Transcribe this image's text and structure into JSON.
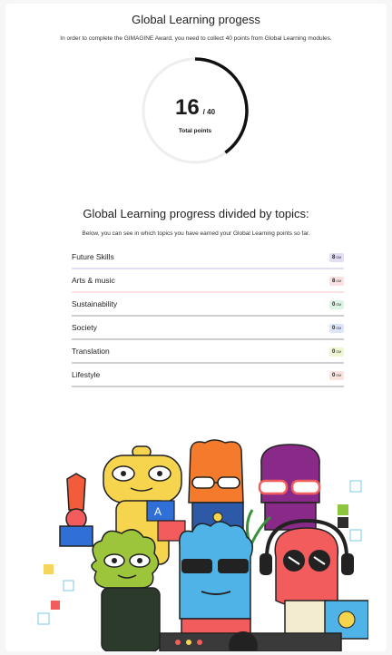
{
  "header": {
    "title": "Global Learning progess",
    "subtitle": "In order to complete the GIMAGINE Award, you need to collect 40 points from Global Learning modules."
  },
  "progress": {
    "points": "16",
    "total": "/ 40",
    "label": "Total points",
    "fraction": 0.4,
    "ring_color": "#111111",
    "track_color": "#eeeeee"
  },
  "topics_section": {
    "title": "Global Learning progress divided by topics:",
    "subtitle": "Below, you can see in which topics you have earned your Global Learning points so far.",
    "unit": "GM",
    "items": [
      {
        "name": "Future Skills",
        "points": "8",
        "fraction": 1.0,
        "color": "#e3ddf6"
      },
      {
        "name": "Arts & music",
        "points": "8",
        "fraction": 1.0,
        "color": "#fbe1e1"
      },
      {
        "name": "Sustainability",
        "points": "0",
        "fraction": 0,
        "color": "#dcf4e3"
      },
      {
        "name": "Society",
        "points": "0",
        "fraction": 0,
        "color": "#dde6f8"
      },
      {
        "name": "Translation",
        "points": "0",
        "fraction": 0,
        "color": "#eef6d2"
      },
      {
        "name": "Lifestyle",
        "points": "0",
        "fraction": 0,
        "color": "#fbe3df"
      }
    ]
  },
  "illustration": {
    "name": "characters-illustration"
  }
}
